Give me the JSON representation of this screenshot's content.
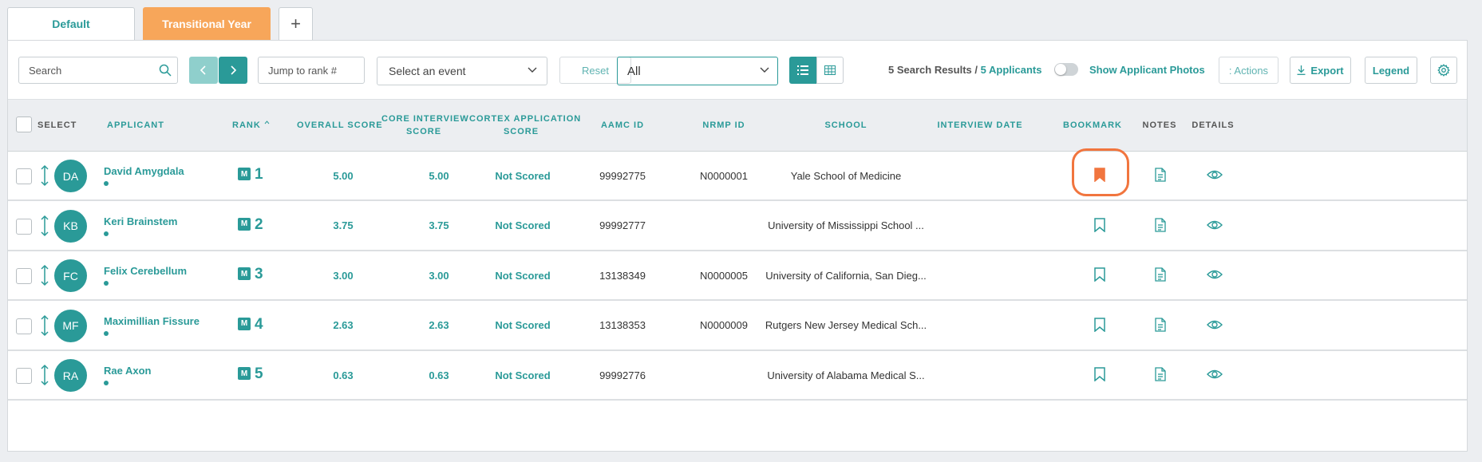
{
  "tabs": [
    {
      "label": "Default"
    },
    {
      "label": "Transitional Year"
    },
    {
      "label": "+"
    }
  ],
  "toolbar": {
    "search_placeholder": "Search",
    "jump_placeholder": "Jump to rank #",
    "event_select": "Select an event",
    "reset": "Reset",
    "filter_select": "All",
    "results_count": "5 Search Results / ",
    "results_applicants": "5 Applicants",
    "show_photos": "Show Applicant Photos",
    "actions": ": Actions",
    "export": "Export",
    "legend": "Legend"
  },
  "columns": {
    "select": "SELECT",
    "applicant": "APPLICANT",
    "rank": "RANK",
    "overall": "OVERALL SCORE",
    "core1": "CORE INTERVIEW",
    "core2": "SCORE",
    "cortex1": "CORTEX APPLICATION",
    "cortex2": "SCORE",
    "aamc": "AAMC ID",
    "nrmp": "NRMP ID",
    "school": "SCHOOL",
    "interview": "INTERVIEW DATE",
    "bookmark": "BOOKMARK",
    "notes": "NOTES",
    "details": "DETAILS"
  },
  "rows": [
    {
      "initials": "DA",
      "name": "David Amygdala",
      "badge": "M",
      "rank": "1",
      "overall": "5.00",
      "core": "5.00",
      "cortex": "Not Scored",
      "aamc": "99992775",
      "nrmp": "N0000001",
      "school": "Yale School of Medicine",
      "bookmarked": true
    },
    {
      "initials": "KB",
      "name": "Keri Brainstem",
      "badge": "M",
      "rank": "2",
      "overall": "3.75",
      "core": "3.75",
      "cortex": "Not Scored",
      "aamc": "99992777",
      "nrmp": "",
      "school": "University of Mississippi School ...",
      "bookmarked": false
    },
    {
      "initials": "FC",
      "name": "Felix Cerebellum",
      "badge": "M",
      "rank": "3",
      "overall": "3.00",
      "core": "3.00",
      "cortex": "Not Scored",
      "aamc": "13138349",
      "nrmp": "N0000005",
      "school": "University of California, San Dieg...",
      "bookmarked": false
    },
    {
      "initials": "MF",
      "name": "Maximillian Fissure",
      "badge": "M",
      "rank": "4",
      "overall": "2.63",
      "core": "2.63",
      "cortex": "Not Scored",
      "aamc": "13138353",
      "nrmp": "N0000009",
      "school": "Rutgers New Jersey Medical Sch...",
      "bookmarked": false
    },
    {
      "initials": "RA",
      "name": "Rae Axon",
      "badge": "M",
      "rank": "5",
      "overall": "0.63",
      "core": "0.63",
      "cortex": "Not Scored",
      "aamc": "99992776",
      "nrmp": "",
      "school": "University of Alabama Medical S...",
      "bookmarked": false
    }
  ],
  "colors": {
    "accent": "#2a9a98",
    "tab_active": "#f7a65a",
    "bookmark_active": "#f1753e"
  }
}
